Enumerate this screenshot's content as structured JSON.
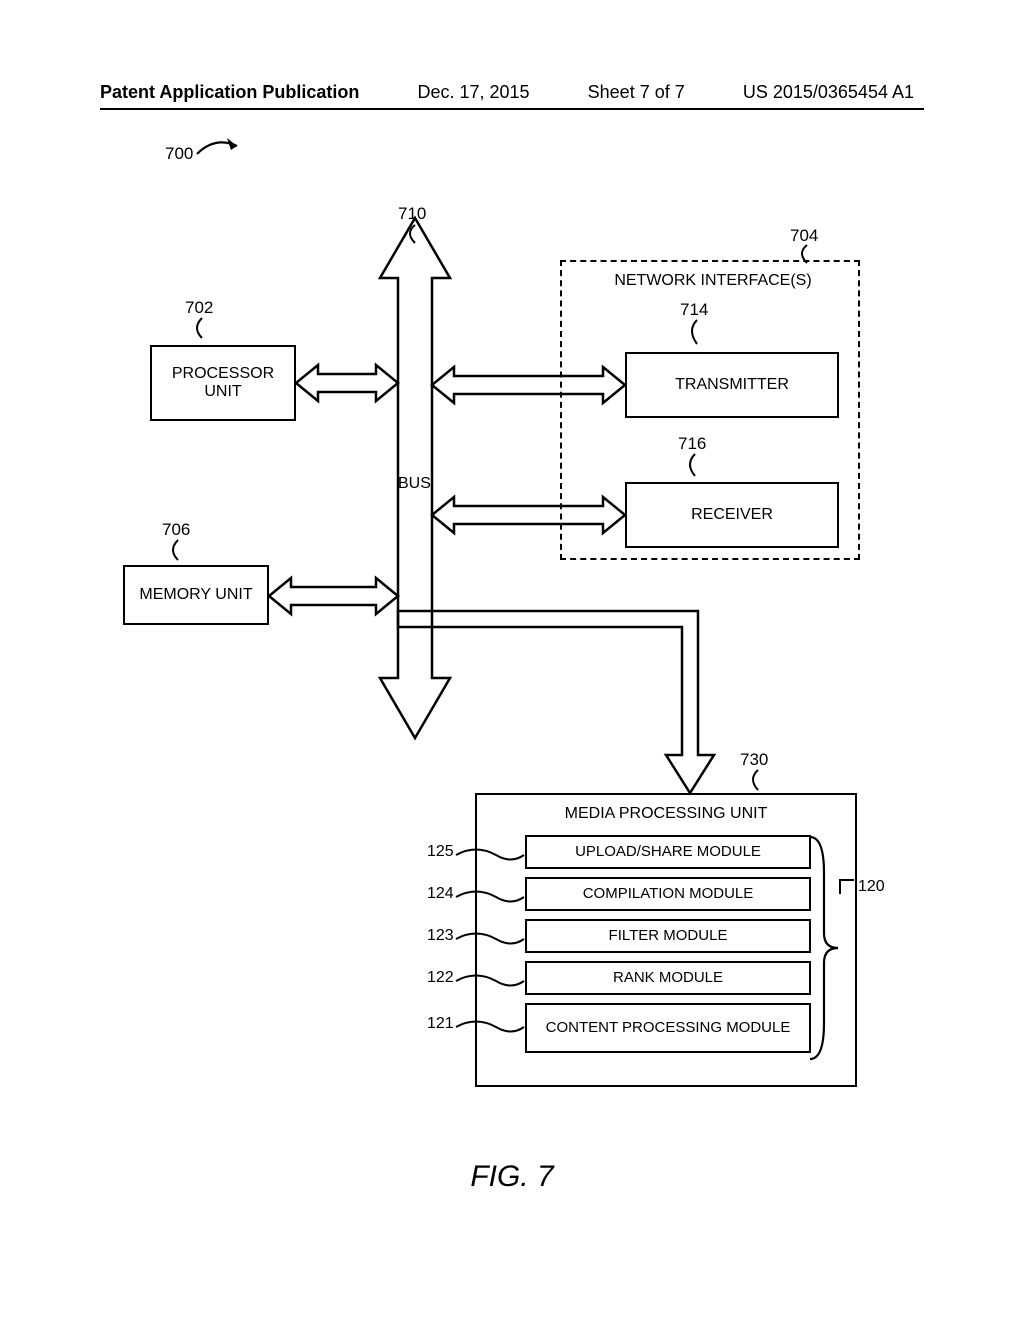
{
  "header": {
    "pub_label": "Patent Application Publication",
    "date": "Dec. 17, 2015",
    "sheet": "Sheet 7 of 7",
    "pubno": "US 2015/0365454 A1"
  },
  "figure": {
    "label": "FIG. 7",
    "overall_ref": "700"
  },
  "refs": {
    "bus": "710",
    "processor": "702",
    "memory": "706",
    "net_if_group": "704",
    "transmitter": "714",
    "receiver": "716",
    "mpu": "730",
    "modules_group": "120",
    "upload": "125",
    "compilation": "124",
    "filter": "123",
    "rank": "122",
    "content": "121"
  },
  "labels": {
    "bus": "BUS",
    "processor": "PROCESSOR UNIT",
    "memory": "MEMORY UNIT",
    "net_if": "NETWORK INTERFACE(S)",
    "transmitter": "TRANSMITTER",
    "receiver": "RECEIVER",
    "mpu": "MEDIA PROCESSING UNIT",
    "upload": "UPLOAD/SHARE  MODULE",
    "compilation": "COMPILATION MODULE",
    "filter": "FILTER MODULE",
    "rank": "RANK MODULE",
    "content": "CONTENT PROCESSING MODULE"
  }
}
